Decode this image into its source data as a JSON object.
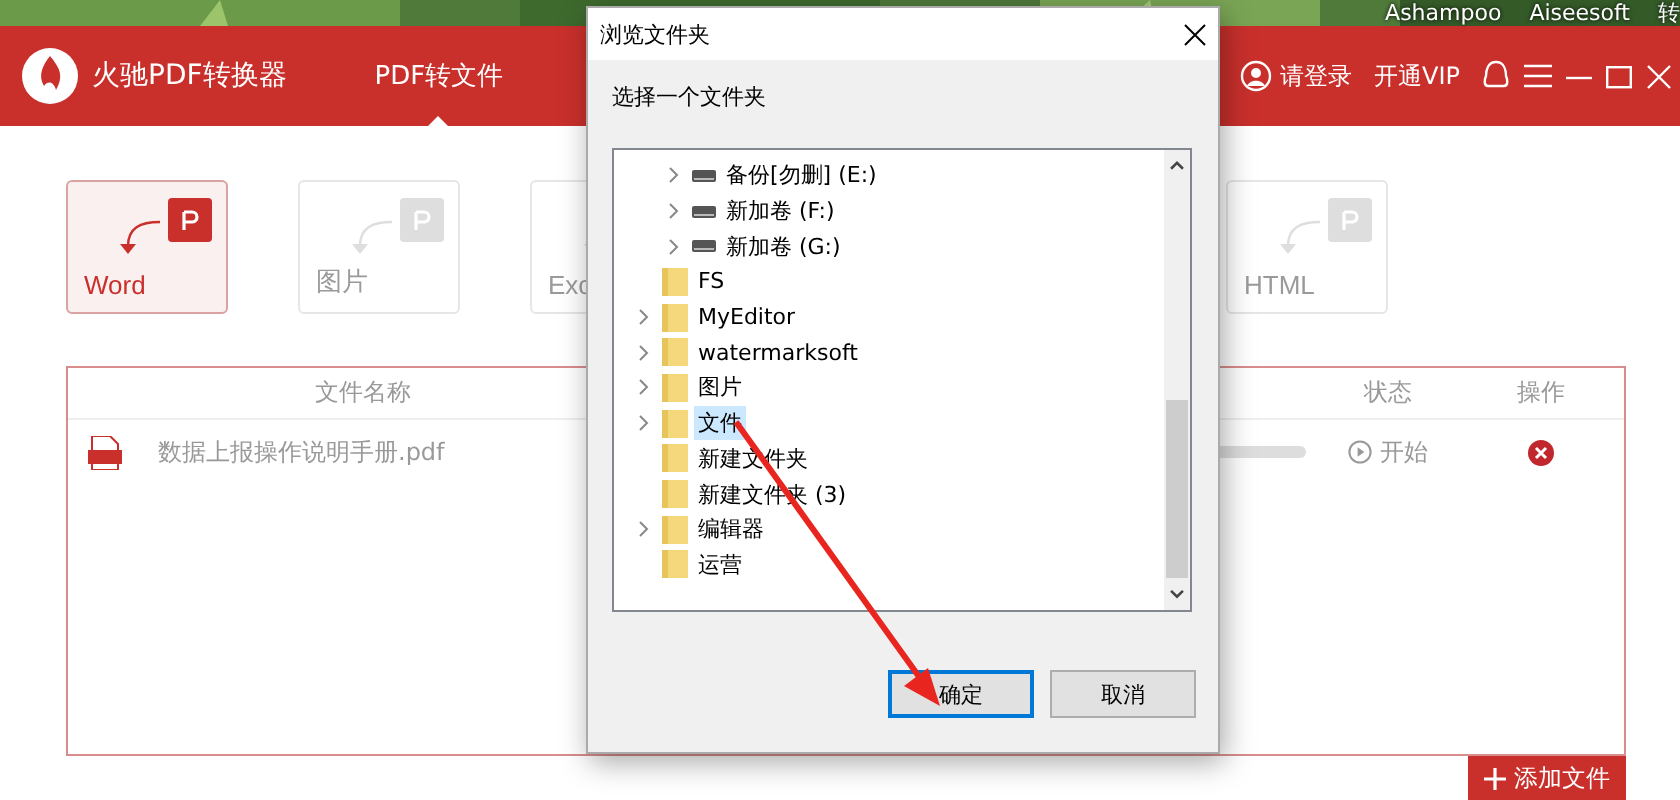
{
  "desktop": {
    "icon_labels": [
      "Ashampoo",
      "Aiseesoft",
      "转"
    ]
  },
  "app": {
    "title": "火驰PDF转换器",
    "tabs": [
      {
        "label": "PDF转文件",
        "selected": true
      }
    ],
    "login": "请登录",
    "vip": "开通VIP"
  },
  "formats": [
    {
      "label": "Word",
      "selected": true
    },
    {
      "label": "图片",
      "selected": false
    },
    {
      "label": "Exc",
      "selected": false
    },
    {
      "label": "HTML",
      "selected": false
    }
  ],
  "file_table": {
    "columns": [
      "文件名称",
      "状态",
      "操作"
    ],
    "rows": [
      {
        "name": "数据上报操作说明手册.pdf",
        "status": "开始"
      }
    ]
  },
  "add_button": "添加文件",
  "dialog": {
    "title": "浏览文件夹",
    "prompt": "选择一个文件夹",
    "tree": [
      {
        "kind": "drive",
        "label": "备份[勿删] (E:)",
        "has_children": true,
        "selected": false
      },
      {
        "kind": "drive",
        "label": "新加卷 (F:)",
        "has_children": true,
        "selected": false
      },
      {
        "kind": "drive",
        "label": "新加卷 (G:)",
        "has_children": true,
        "selected": false
      },
      {
        "kind": "folder",
        "label": "FS",
        "has_children": false,
        "selected": false
      },
      {
        "kind": "folder",
        "label": "MyEditor",
        "has_children": true,
        "selected": false
      },
      {
        "kind": "folder",
        "label": "watermarksoft",
        "has_children": true,
        "selected": false
      },
      {
        "kind": "folder",
        "label": "图片",
        "has_children": true,
        "selected": false
      },
      {
        "kind": "folder",
        "label": "文件",
        "has_children": true,
        "selected": true
      },
      {
        "kind": "folder",
        "label": "新建文件夹",
        "has_children": false,
        "selected": false
      },
      {
        "kind": "folder",
        "label": "新建文件夹 (3)",
        "has_children": false,
        "selected": false
      },
      {
        "kind": "folder",
        "label": "编辑器",
        "has_children": true,
        "selected": false
      },
      {
        "kind": "folder",
        "label": "运营",
        "has_children": false,
        "selected": false
      }
    ],
    "buttons": [
      {
        "label": "确定",
        "default": true
      },
      {
        "label": "取消",
        "default": false
      }
    ]
  }
}
